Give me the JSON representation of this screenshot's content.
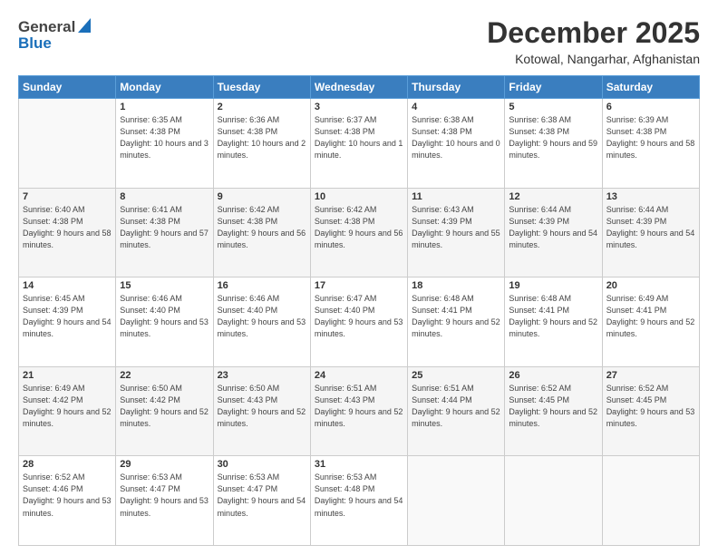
{
  "header": {
    "logo_general": "General",
    "logo_blue": "Blue",
    "title": "December 2025",
    "location": "Kotowal, Nangarhar, Afghanistan"
  },
  "days_of_week": [
    "Sunday",
    "Monday",
    "Tuesday",
    "Wednesday",
    "Thursday",
    "Friday",
    "Saturday"
  ],
  "weeks": [
    [
      {
        "day": "",
        "sunrise": "",
        "sunset": "",
        "daylight": "",
        "empty": true
      },
      {
        "day": "1",
        "sunrise": "Sunrise: 6:35 AM",
        "sunset": "Sunset: 4:38 PM",
        "daylight": "Daylight: 10 hours and 3 minutes.",
        "empty": false
      },
      {
        "day": "2",
        "sunrise": "Sunrise: 6:36 AM",
        "sunset": "Sunset: 4:38 PM",
        "daylight": "Daylight: 10 hours and 2 minutes.",
        "empty": false
      },
      {
        "day": "3",
        "sunrise": "Sunrise: 6:37 AM",
        "sunset": "Sunset: 4:38 PM",
        "daylight": "Daylight: 10 hours and 1 minute.",
        "empty": false
      },
      {
        "day": "4",
        "sunrise": "Sunrise: 6:38 AM",
        "sunset": "Sunset: 4:38 PM",
        "daylight": "Daylight: 10 hours and 0 minutes.",
        "empty": false
      },
      {
        "day": "5",
        "sunrise": "Sunrise: 6:38 AM",
        "sunset": "Sunset: 4:38 PM",
        "daylight": "Daylight: 9 hours and 59 minutes.",
        "empty": false
      },
      {
        "day": "6",
        "sunrise": "Sunrise: 6:39 AM",
        "sunset": "Sunset: 4:38 PM",
        "daylight": "Daylight: 9 hours and 58 minutes.",
        "empty": false
      }
    ],
    [
      {
        "day": "7",
        "sunrise": "Sunrise: 6:40 AM",
        "sunset": "Sunset: 4:38 PM",
        "daylight": "Daylight: 9 hours and 58 minutes.",
        "empty": false
      },
      {
        "day": "8",
        "sunrise": "Sunrise: 6:41 AM",
        "sunset": "Sunset: 4:38 PM",
        "daylight": "Daylight: 9 hours and 57 minutes.",
        "empty": false
      },
      {
        "day": "9",
        "sunrise": "Sunrise: 6:42 AM",
        "sunset": "Sunset: 4:38 PM",
        "daylight": "Daylight: 9 hours and 56 minutes.",
        "empty": false
      },
      {
        "day": "10",
        "sunrise": "Sunrise: 6:42 AM",
        "sunset": "Sunset: 4:38 PM",
        "daylight": "Daylight: 9 hours and 56 minutes.",
        "empty": false
      },
      {
        "day": "11",
        "sunrise": "Sunrise: 6:43 AM",
        "sunset": "Sunset: 4:39 PM",
        "daylight": "Daylight: 9 hours and 55 minutes.",
        "empty": false
      },
      {
        "day": "12",
        "sunrise": "Sunrise: 6:44 AM",
        "sunset": "Sunset: 4:39 PM",
        "daylight": "Daylight: 9 hours and 54 minutes.",
        "empty": false
      },
      {
        "day": "13",
        "sunrise": "Sunrise: 6:44 AM",
        "sunset": "Sunset: 4:39 PM",
        "daylight": "Daylight: 9 hours and 54 minutes.",
        "empty": false
      }
    ],
    [
      {
        "day": "14",
        "sunrise": "Sunrise: 6:45 AM",
        "sunset": "Sunset: 4:39 PM",
        "daylight": "Daylight: 9 hours and 54 minutes.",
        "empty": false
      },
      {
        "day": "15",
        "sunrise": "Sunrise: 6:46 AM",
        "sunset": "Sunset: 4:40 PM",
        "daylight": "Daylight: 9 hours and 53 minutes.",
        "empty": false
      },
      {
        "day": "16",
        "sunrise": "Sunrise: 6:46 AM",
        "sunset": "Sunset: 4:40 PM",
        "daylight": "Daylight: 9 hours and 53 minutes.",
        "empty": false
      },
      {
        "day": "17",
        "sunrise": "Sunrise: 6:47 AM",
        "sunset": "Sunset: 4:40 PM",
        "daylight": "Daylight: 9 hours and 53 minutes.",
        "empty": false
      },
      {
        "day": "18",
        "sunrise": "Sunrise: 6:48 AM",
        "sunset": "Sunset: 4:41 PM",
        "daylight": "Daylight: 9 hours and 52 minutes.",
        "empty": false
      },
      {
        "day": "19",
        "sunrise": "Sunrise: 6:48 AM",
        "sunset": "Sunset: 4:41 PM",
        "daylight": "Daylight: 9 hours and 52 minutes.",
        "empty": false
      },
      {
        "day": "20",
        "sunrise": "Sunrise: 6:49 AM",
        "sunset": "Sunset: 4:41 PM",
        "daylight": "Daylight: 9 hours and 52 minutes.",
        "empty": false
      }
    ],
    [
      {
        "day": "21",
        "sunrise": "Sunrise: 6:49 AM",
        "sunset": "Sunset: 4:42 PM",
        "daylight": "Daylight: 9 hours and 52 minutes.",
        "empty": false
      },
      {
        "day": "22",
        "sunrise": "Sunrise: 6:50 AM",
        "sunset": "Sunset: 4:42 PM",
        "daylight": "Daylight: 9 hours and 52 minutes.",
        "empty": false
      },
      {
        "day": "23",
        "sunrise": "Sunrise: 6:50 AM",
        "sunset": "Sunset: 4:43 PM",
        "daylight": "Daylight: 9 hours and 52 minutes.",
        "empty": false
      },
      {
        "day": "24",
        "sunrise": "Sunrise: 6:51 AM",
        "sunset": "Sunset: 4:43 PM",
        "daylight": "Daylight: 9 hours and 52 minutes.",
        "empty": false
      },
      {
        "day": "25",
        "sunrise": "Sunrise: 6:51 AM",
        "sunset": "Sunset: 4:44 PM",
        "daylight": "Daylight: 9 hours and 52 minutes.",
        "empty": false
      },
      {
        "day": "26",
        "sunrise": "Sunrise: 6:52 AM",
        "sunset": "Sunset: 4:45 PM",
        "daylight": "Daylight: 9 hours and 52 minutes.",
        "empty": false
      },
      {
        "day": "27",
        "sunrise": "Sunrise: 6:52 AM",
        "sunset": "Sunset: 4:45 PM",
        "daylight": "Daylight: 9 hours and 53 minutes.",
        "empty": false
      }
    ],
    [
      {
        "day": "28",
        "sunrise": "Sunrise: 6:52 AM",
        "sunset": "Sunset: 4:46 PM",
        "daylight": "Daylight: 9 hours and 53 minutes.",
        "empty": false
      },
      {
        "day": "29",
        "sunrise": "Sunrise: 6:53 AM",
        "sunset": "Sunset: 4:47 PM",
        "daylight": "Daylight: 9 hours and 53 minutes.",
        "empty": false
      },
      {
        "day": "30",
        "sunrise": "Sunrise: 6:53 AM",
        "sunset": "Sunset: 4:47 PM",
        "daylight": "Daylight: 9 hours and 54 minutes.",
        "empty": false
      },
      {
        "day": "31",
        "sunrise": "Sunrise: 6:53 AM",
        "sunset": "Sunset: 4:48 PM",
        "daylight": "Daylight: 9 hours and 54 minutes.",
        "empty": false
      },
      {
        "day": "",
        "sunrise": "",
        "sunset": "",
        "daylight": "",
        "empty": true
      },
      {
        "day": "",
        "sunrise": "",
        "sunset": "",
        "daylight": "",
        "empty": true
      },
      {
        "day": "",
        "sunrise": "",
        "sunset": "",
        "daylight": "",
        "empty": true
      }
    ]
  ]
}
